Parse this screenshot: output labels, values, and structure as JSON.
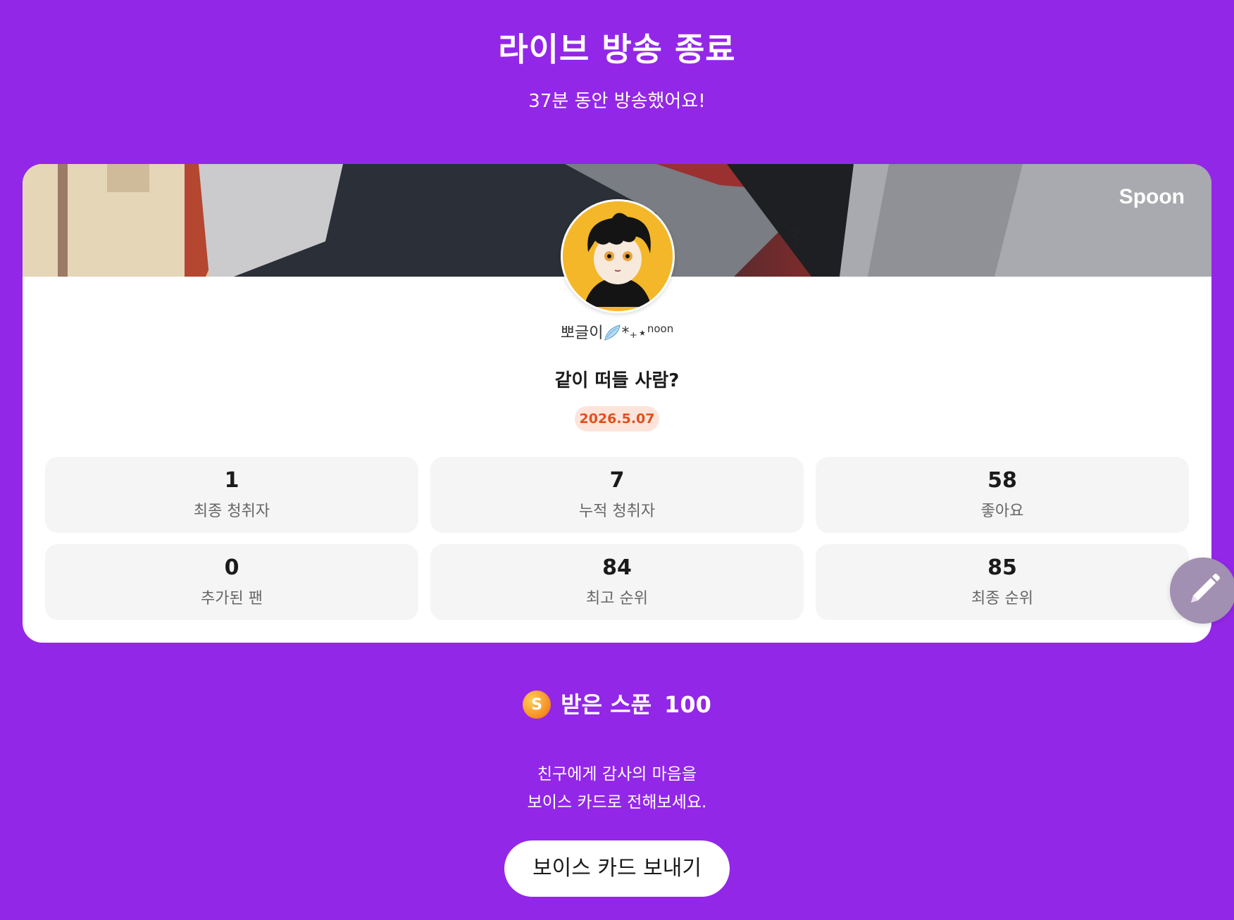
{
  "header": {
    "title": "라이브 방송 종료",
    "subtitle": "37분 동안 방송했어요!"
  },
  "card": {
    "brand": "Spoon",
    "nickname": "뽀글이",
    "nickname_suffix": "*₊⋆",
    "nickname_sup": "noon",
    "live_title": "같이 떠들 사람?",
    "date": "2026.5.07",
    "stats": [
      {
        "value": "1",
        "label": "최종 청취자"
      },
      {
        "value": "7",
        "label": "누적 청취자"
      },
      {
        "value": "58",
        "label": "좋아요"
      },
      {
        "value": "0",
        "label": "추가된 팬"
      },
      {
        "value": "84",
        "label": "최고 순위"
      },
      {
        "value": "85",
        "label": "최종 순위"
      }
    ]
  },
  "spoons": {
    "coin_glyph": "S",
    "label": "받은 스푼",
    "count": "100"
  },
  "message": {
    "line1": "친구에게 감사의 마음을",
    "line2": "보이스 카드로 전해보세요."
  },
  "actions": {
    "voice_card_button": "보이스 카드 보내기"
  },
  "colors": {
    "background": "#9327e8",
    "card": "#ffffff",
    "date_badge_text": "#e0501f",
    "date_badge_bg": "#fde4da"
  },
  "icons": [
    "wing-icon",
    "pencil-icon",
    "spoon-coin-icon"
  ]
}
